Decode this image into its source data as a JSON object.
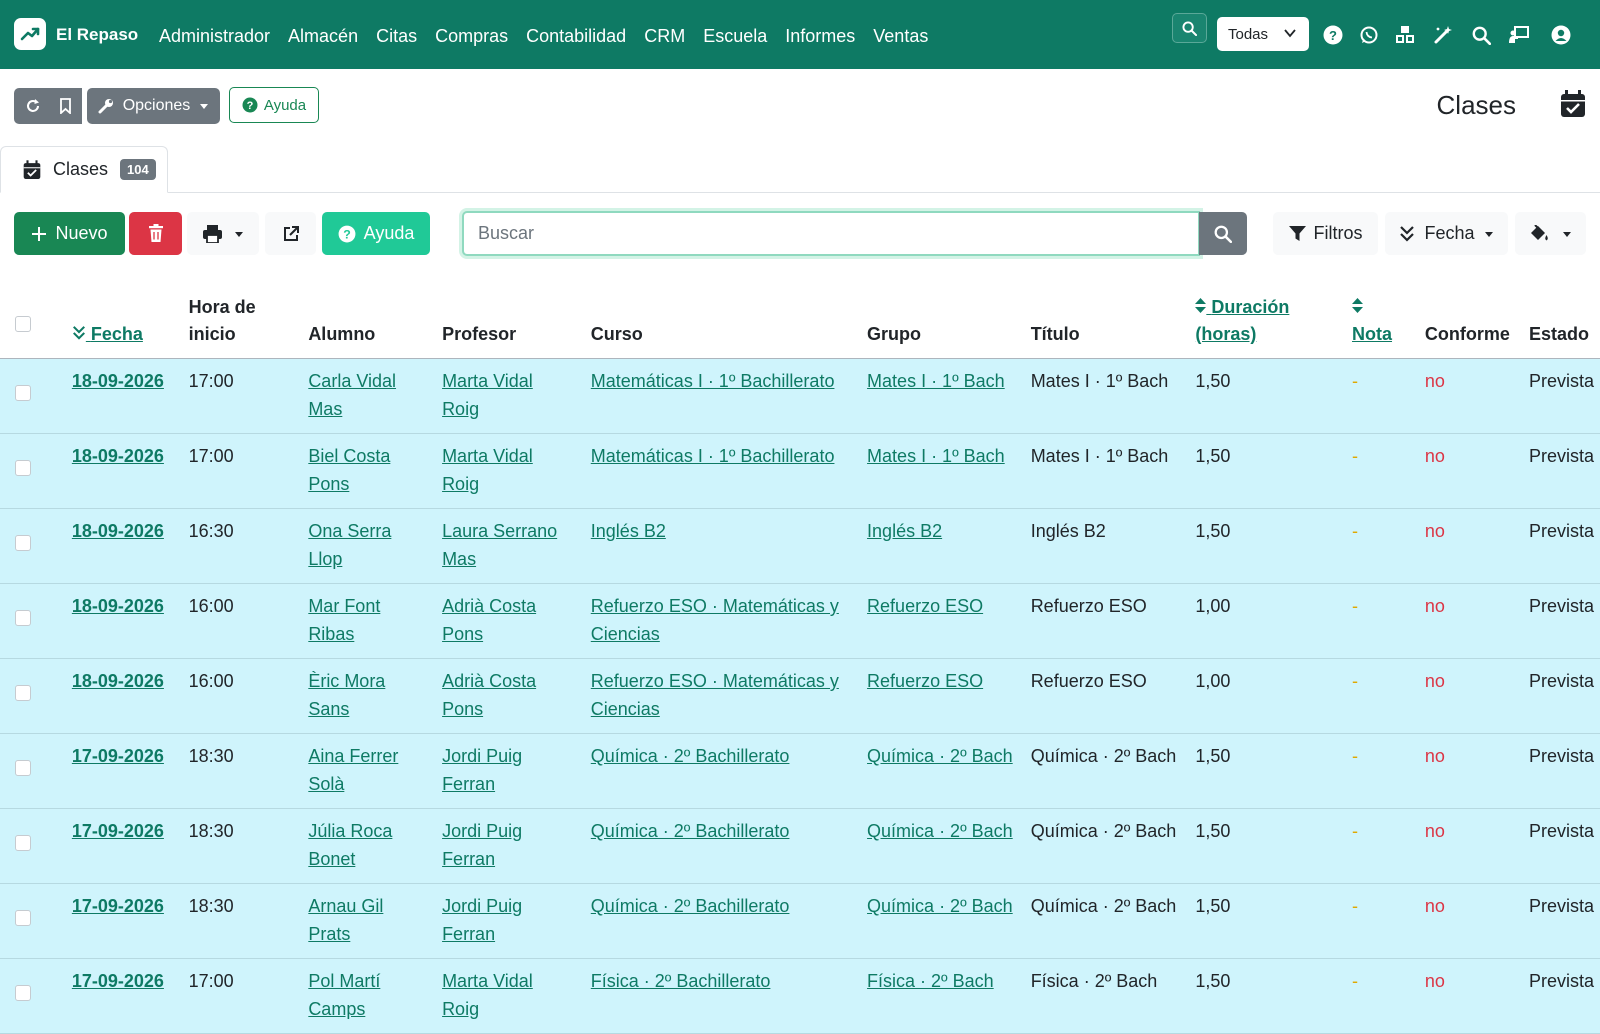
{
  "app": {
    "brand": "El Repaso"
  },
  "nav": {
    "menu": [
      "Administrador",
      "Almacén",
      "Citas",
      "Compras",
      "Contabilidad",
      "CRM",
      "Escuela",
      "Informes",
      "Ventas"
    ],
    "scope_select": "Todas"
  },
  "toolbar": {
    "options_label": "Opciones",
    "help_label": "Ayuda"
  },
  "page": {
    "title": "Clases"
  },
  "tab": {
    "label": "Clases",
    "count": "104"
  },
  "actions": {
    "new_label": "Nuevo",
    "help_label": "Ayuda",
    "search_placeholder": "Buscar",
    "filters_label": "Filtros",
    "date_label": "Fecha"
  },
  "table": {
    "headers": {
      "fecha": "Fecha",
      "hora_1": "Hora de",
      "hora_2": "inicio",
      "alumno": "Alumno",
      "profesor": "Profesor",
      "curso": "Curso",
      "grupo": "Grupo",
      "titulo": "Título",
      "duracion_1": "Duración",
      "duracion_2": "(horas)",
      "nota": "Nota",
      "conforme": "Conforme",
      "estado": "Estado"
    },
    "rows": [
      {
        "fecha": "18-09-2026",
        "hora": "17:00",
        "alumno_1": "Carla Vidal",
        "alumno_2": "Mas",
        "profesor_1": "Marta Vidal",
        "profesor_2": "Roig",
        "curso_1": "Matemáticas I · 1º Bachillerato",
        "curso_2": "",
        "grupo": "Mates I · 1º Bach",
        "titulo": "Mates I · 1º Bach",
        "duracion": "1,50",
        "nota": "-",
        "conforme": "no",
        "estado": "Prevista"
      },
      {
        "fecha": "18-09-2026",
        "hora": "17:00",
        "alumno_1": "Biel Costa",
        "alumno_2": "Pons",
        "profesor_1": "Marta Vidal",
        "profesor_2": "Roig",
        "curso_1": "Matemáticas I · 1º Bachillerato",
        "curso_2": "",
        "grupo": "Mates I · 1º Bach",
        "titulo": "Mates I · 1º Bach",
        "duracion": "1,50",
        "nota": "-",
        "conforme": "no",
        "estado": "Prevista"
      },
      {
        "fecha": "18-09-2026",
        "hora": "16:30",
        "alumno_1": "Ona Serra",
        "alumno_2": "Llop",
        "profesor_1": "Laura Serrano",
        "profesor_2": "Mas",
        "curso_1": "Inglés B2",
        "curso_2": "",
        "grupo": "Inglés B2",
        "titulo": "Inglés B2",
        "duracion": "1,50",
        "nota": "-",
        "conforme": "no",
        "estado": "Prevista"
      },
      {
        "fecha": "18-09-2026",
        "hora": "16:00",
        "alumno_1": "Mar Font",
        "alumno_2": "Ribas",
        "profesor_1": "Adrià Costa",
        "profesor_2": "Pons",
        "curso_1": "Refuerzo ESO · Matemáticas y",
        "curso_2": "Ciencias",
        "grupo": "Refuerzo ESO",
        "titulo": "Refuerzo ESO",
        "duracion": "1,00",
        "nota": "-",
        "conforme": "no",
        "estado": "Prevista"
      },
      {
        "fecha": "18-09-2026",
        "hora": "16:00",
        "alumno_1": "Èric Mora",
        "alumno_2": "Sans",
        "profesor_1": "Adrià Costa",
        "profesor_2": "Pons",
        "curso_1": "Refuerzo ESO · Matemáticas y",
        "curso_2": "Ciencias",
        "grupo": "Refuerzo ESO",
        "titulo": "Refuerzo ESO",
        "duracion": "1,00",
        "nota": "-",
        "conforme": "no",
        "estado": "Prevista"
      },
      {
        "fecha": "17-09-2026",
        "hora": "18:30",
        "alumno_1": "Aina Ferrer",
        "alumno_2": "Solà",
        "profesor_1": "Jordi Puig",
        "profesor_2": "Ferran",
        "curso_1": "Química · 2º Bachillerato",
        "curso_2": "",
        "grupo": "Química · 2º Bach",
        "titulo": "Química · 2º Bach",
        "duracion": "1,50",
        "nota": "-",
        "conforme": "no",
        "estado": "Prevista"
      },
      {
        "fecha": "17-09-2026",
        "hora": "18:30",
        "alumno_1": "Júlia Roca",
        "alumno_2": "Bonet",
        "profesor_1": "Jordi Puig",
        "profesor_2": "Ferran",
        "curso_1": "Química · 2º Bachillerato",
        "curso_2": "",
        "grupo": "Química · 2º Bach",
        "titulo": "Química · 2º Bach",
        "duracion": "1,50",
        "nota": "-",
        "conforme": "no",
        "estado": "Prevista"
      },
      {
        "fecha": "17-09-2026",
        "hora": "18:30",
        "alumno_1": "Arnau Gil",
        "alumno_2": "Prats",
        "profesor_1": "Jordi Puig",
        "profesor_2": "Ferran",
        "curso_1": "Química · 2º Bachillerato",
        "curso_2": "",
        "grupo": "Química · 2º Bach",
        "titulo": "Química · 2º Bach",
        "duracion": "1,50",
        "nota": "-",
        "conforme": "no",
        "estado": "Prevista"
      },
      {
        "fecha": "17-09-2026",
        "hora": "17:00",
        "alumno_1": "Pol Martí",
        "alumno_2": "Camps",
        "profesor_1": "Marta Vidal",
        "profesor_2": "Roig",
        "curso_1": "Física · 2º Bachillerato",
        "curso_2": "",
        "grupo": "Física · 2º Bach",
        "titulo": "Física · 2º Bach",
        "duracion": "1,50",
        "nota": "-",
        "conforme": "no",
        "estado": "Prevista"
      }
    ]
  },
  "colors": {
    "primary": "#0e7a64",
    "row_bg": "#cff4fc",
    "danger": "#dc3545",
    "success": "#198754",
    "info": "#20c997"
  }
}
